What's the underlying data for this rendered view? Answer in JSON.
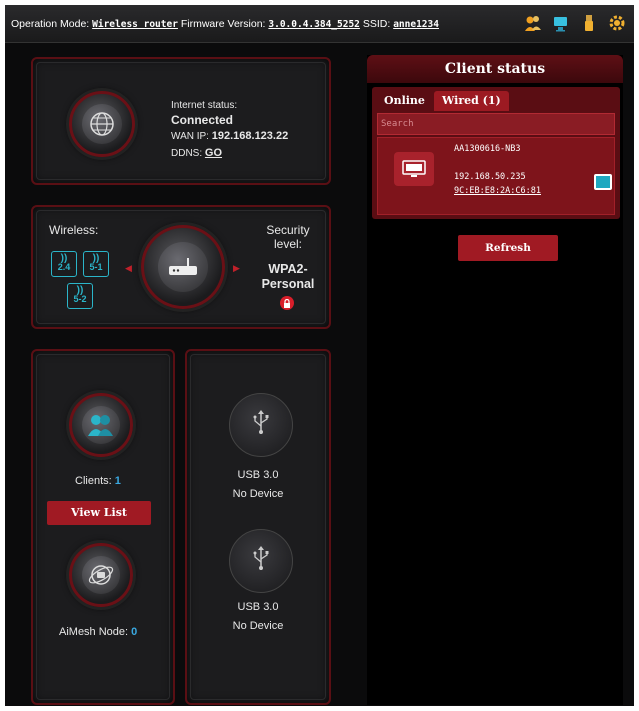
{
  "topbar": {
    "op_mode_label": "Operation Mode:",
    "op_mode_value": "Wireless router",
    "fw_label": "Firmware Version:",
    "fw_value": "3.0.0.4.384_5252",
    "ssid_label": "SSID:",
    "ssid_value": "anne1234",
    "icons": [
      "users-icon",
      "network-monitor-icon",
      "usb-icon",
      "gear-icon"
    ]
  },
  "internet": {
    "status_label": "Internet status:",
    "status_value": "Connected",
    "wan_label": "WAN IP:",
    "wan_value": "192.168.123.22",
    "ddns_label": "DDNS:",
    "ddns_value": "GO"
  },
  "wireless": {
    "label": "Wireless:",
    "bands": [
      "2.4",
      "5-1",
      "5-2"
    ],
    "security_label": "Security level:",
    "security_value": "WPA2-Personal"
  },
  "clients": {
    "label": "Clients:",
    "count": "1",
    "view_list": "View List"
  },
  "aimesh": {
    "label": "AiMesh Node:",
    "count": "0"
  },
  "usb": [
    {
      "label": "USB 3.0",
      "status": "No Device"
    },
    {
      "label": "USB 3.0",
      "status": "No Device"
    }
  ],
  "client_status": {
    "title": "Client status",
    "tabs": [
      "Online",
      "Wired (1)"
    ],
    "search_placeholder": "Search",
    "device": {
      "name": "AA1300616-NB3",
      "ip": "192.168.50.235",
      "mac": "9C:EB:E8:2A:C6:81"
    },
    "refresh": "Refresh"
  },
  "colors": {
    "accent_red": "#a01a23",
    "wifi_cyan": "#2bb5c9",
    "count_blue": "#3aa8e0"
  }
}
